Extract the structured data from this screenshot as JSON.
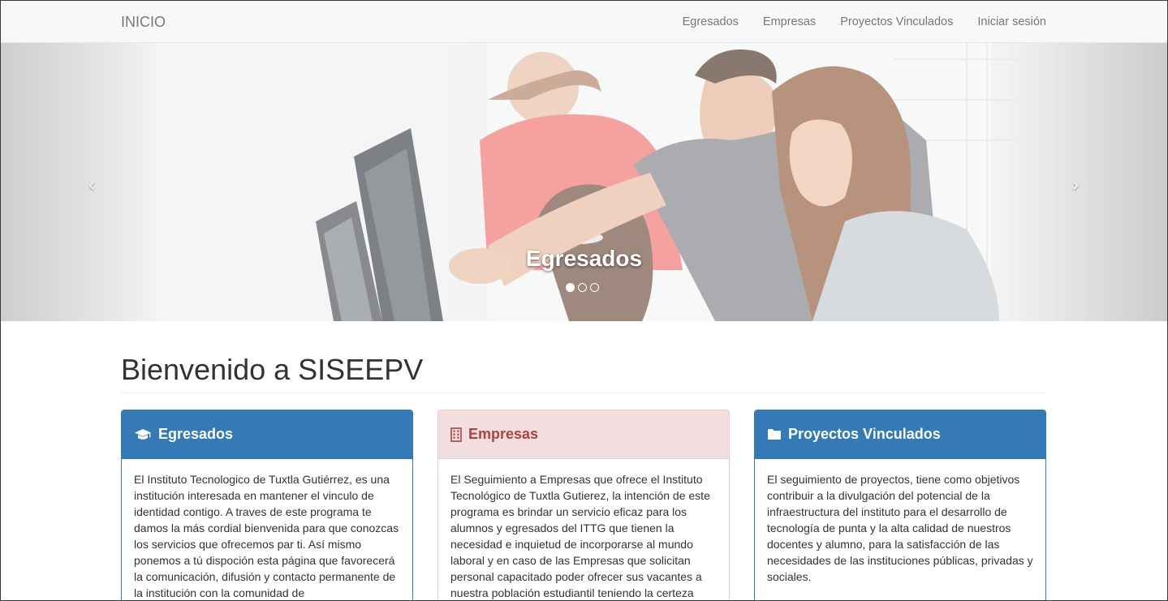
{
  "navbar": {
    "brand": "INICIO",
    "links": [
      "Egresados",
      "Empresas",
      "Proyectos Vinculados",
      "Iniciar sesión"
    ]
  },
  "carousel": {
    "caption": "Egresados",
    "prev_icon": "chevron-left-icon",
    "next_icon": "chevron-right-icon",
    "slide_count": 3,
    "active_index": 0
  },
  "main": {
    "title": "Bienvenido a SISEEPV",
    "panels": [
      {
        "title": "Egresados",
        "icon": "graduation-cap-icon",
        "style": "primary",
        "text": "El Instituto Tecnologico de Tuxtla Gutiérrez, es una institución interesada en mantener el vinculo de identidad contigo. A traves de este programa te damos la más cordial bienvenida para que conozcas los servicios que ofrecemos par ti. Así mismo ponemos a tú dispoción esta página que favorecerá la comunicación, difusión y contacto permanente de la institución con la comunidad de"
      },
      {
        "title": "Empresas",
        "icon": "building-icon",
        "style": "danger",
        "text": "El Seguimiento a Empresas que ofrece el Instituto Tecnológico de Tuxtla Gutierez, la intención de este programa es brindar un servicio eficaz para los alumnos y egresados del ITTG que tienen la necesidad e inquietud de incorporarse al mundo laboral y en caso de las Empresas que solicitan personal capacitado poder ofrecer sus vacantes a nuestra población estudiantil teniendo la certeza"
      },
      {
        "title": "Proyectos Vinculados",
        "icon": "folder-icon",
        "style": "primary",
        "text": "El seguimiento de proyectos, tiene como objetivos contribuir a la divulgación del potencial de la infraestructura del instituto para el desarrollo de tecnología de punta y la alta calidad de nuestros docentes y alumno, para la satisfacción de las necesidades de las instituciones públicas, privadas y sociales."
      }
    ]
  },
  "colors": {
    "primary": "#337ab7",
    "danger_bg": "#f2dede",
    "danger_text": "#a94442",
    "navbar_bg": "#f8f8f8",
    "nav_text": "#777777"
  }
}
